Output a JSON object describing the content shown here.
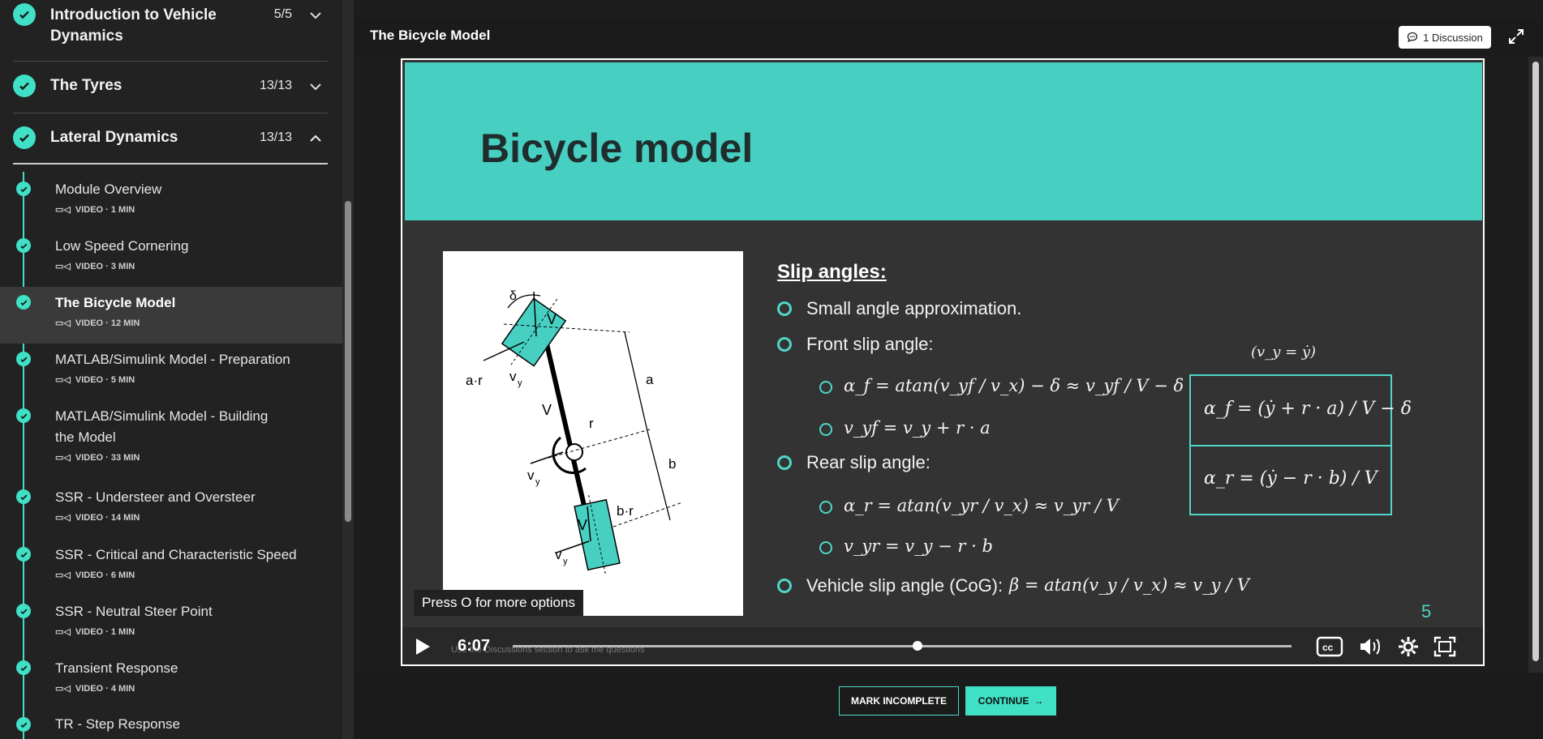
{
  "sidebar": {
    "modules": [
      {
        "title": "Introduction to Vehicle Dynamics",
        "count": "5/5",
        "expanded": false
      },
      {
        "title": "The Tyres",
        "count": "13/13",
        "expanded": false
      },
      {
        "title": "Lateral Dynamics",
        "count": "13/13",
        "expanded": true
      }
    ],
    "items": [
      {
        "title": "Module Overview",
        "meta": "VIDEO · 1 MIN"
      },
      {
        "title": "Low Speed Cornering",
        "meta": "VIDEO · 3 MIN"
      },
      {
        "title": "The Bicycle Model",
        "meta": "VIDEO · 12 MIN",
        "active": true
      },
      {
        "title": "MATLAB/Simulink Model - Preparation",
        "meta": "VIDEO · 5 MIN"
      },
      {
        "title": "MATLAB/Simulink Model - Building the Model",
        "meta": "VIDEO · 33 MIN"
      },
      {
        "title": "SSR - Understeer and Oversteer",
        "meta": "VIDEO · 14 MIN"
      },
      {
        "title": "SSR - Critical and Characteristic Speed",
        "meta": "VIDEO · 6 MIN"
      },
      {
        "title": "SSR - Neutral Steer Point",
        "meta": "VIDEO · 1 MIN"
      },
      {
        "title": "Transient Response",
        "meta": "VIDEO · 4 MIN"
      },
      {
        "title": "TR - Step Response",
        "meta": ""
      }
    ]
  },
  "header": {
    "lesson_title": "The Bicycle Model",
    "discussion_label": "1 Discussion"
  },
  "slide": {
    "title": "Bicycle model",
    "slip_heading": "Slip angles:",
    "bullets": {
      "small_angle": "Small angle approximation.",
      "front": "Front slip angle:",
      "rear": "Rear slip angle:",
      "vehicle": "Vehicle slip angle (CoG):"
    },
    "formulas": {
      "alpha_f": "α_f = atan(v_yf / v_x) − δ ≈ v_yf / V − δ",
      "v_yf": "v_yf = v_y + r · a",
      "alpha_r": "α_r = atan(v_yr / v_x) ≈ v_yr / V",
      "v_yr": "v_yr = v_y − r · b",
      "beta": "β = atan(v_y / v_x) ≈ v_y / V",
      "vy_note": "(v_y = ẏ)",
      "box_f": "α_f = (ẏ + r · a) / V − δ",
      "box_r": "α_r = (ẏ − r · b) / V"
    },
    "diagram_labels": {
      "delta": "δ",
      "v_front": "V",
      "ar": "a·r",
      "vy_front": "v",
      "v_mid": "V",
      "r": "r",
      "a": "a",
      "vy_mid": "v",
      "b": "b",
      "br": "b·r",
      "v_rear": "V",
      "vy_rear": "v",
      "sub_y": "y"
    },
    "page_number": "5"
  },
  "player": {
    "tooltip": "Press O for more options",
    "time": "6:07",
    "progress": 0.52,
    "ghost_text": "Use the Discussions section to ask me questions"
  },
  "footer": {
    "mark_incomplete": "MARK INCOMPLETE",
    "continue": "CONTINUE"
  },
  "colors": {
    "accent": "#3fe0c5",
    "banner": "#47cfc2"
  }
}
